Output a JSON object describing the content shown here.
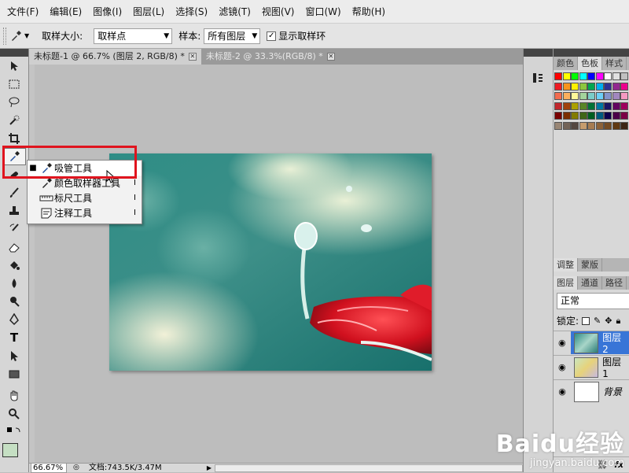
{
  "menu": [
    "文件(F)",
    "编辑(E)",
    "图像(I)",
    "图层(L)",
    "选择(S)",
    "滤镜(T)",
    "视图(V)",
    "窗口(W)",
    "帮助(H)"
  ],
  "options": {
    "sample_size_label": "取样大小:",
    "sample_size_value": "取样点",
    "sample_label": "样本:",
    "sample_value": "所有图层",
    "show_ring_label": "显示取样环",
    "show_ring_checked": true
  },
  "tabs": [
    {
      "label": "未标题-1 @ 66.7% (图层 2, RGB/8) *",
      "active": true
    },
    {
      "label": "未标题-2 @ 33.3%(RGB/8) *",
      "active": false
    }
  ],
  "flyout": [
    {
      "label": "吸管工具",
      "key": "",
      "selected": true,
      "icon": "eyedropper-icon"
    },
    {
      "label": "颜色取样器工具",
      "key": "I",
      "selected": false,
      "icon": "color-sampler-icon"
    },
    {
      "label": "标尺工具",
      "key": "I",
      "selected": false,
      "icon": "ruler-icon"
    },
    {
      "label": "注释工具",
      "key": "I",
      "selected": false,
      "icon": "note-icon"
    }
  ],
  "status": {
    "zoom": "66.67%",
    "doc": "文档:743.5K/3.47M"
  },
  "panels": {
    "swatch_tabs": [
      "颜色",
      "色板",
      "样式"
    ],
    "adjust_tabs": [
      "调整",
      "蒙版"
    ],
    "layer_tabs": [
      "图层",
      "通道",
      "路径"
    ],
    "blend_mode": "正常",
    "lock_label": "锁定:",
    "layers": [
      {
        "name": "图层 2",
        "active": true
      },
      {
        "name": "图层 1",
        "active": false
      },
      {
        "name": "背景",
        "active": false
      }
    ]
  },
  "watermark": {
    "line1": "Baidu经验",
    "line2": "jingyan.baidu.com"
  },
  "colors": {
    "accent": "#3875d7",
    "highlight": "#e0141e"
  }
}
